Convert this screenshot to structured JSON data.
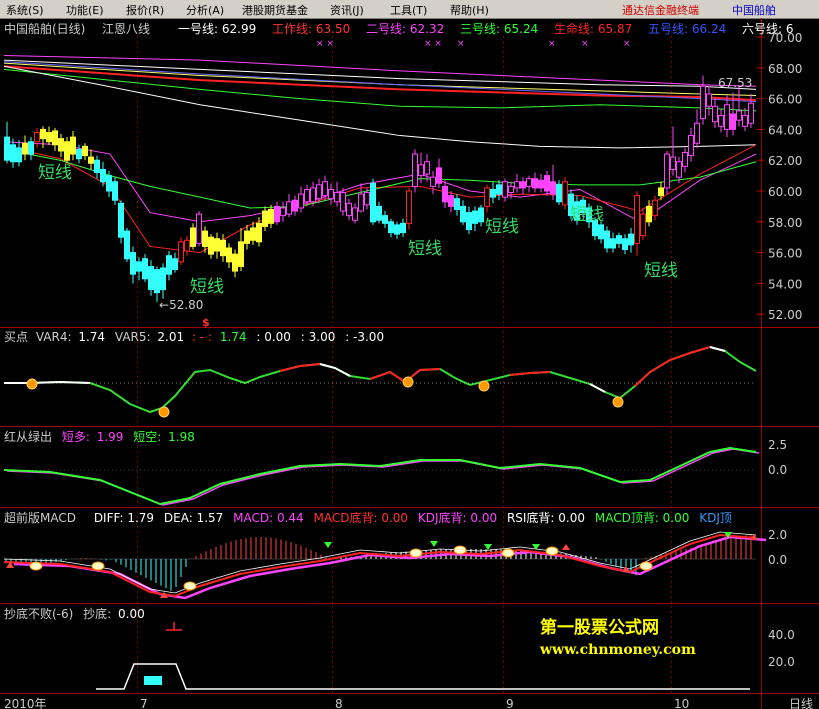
{
  "menu": {
    "items": [
      {
        "label": "系统(S)"
      },
      {
        "label": "功能(E)"
      },
      {
        "label": "报价(R)"
      },
      {
        "label": "分析(A)"
      },
      {
        "label": "港股期货基金"
      },
      {
        "label": "资讯(J)"
      },
      {
        "label": "工具(T)"
      },
      {
        "label": "帮助(H)"
      }
    ],
    "right_title": "通达信金融终端",
    "right_stock": "中国船舶"
  },
  "main_panel": {
    "stock_title": "中国船舶(日线)",
    "indicator_name": "江恩八线",
    "lines": [
      {
        "label": "一号线:",
        "value": "62.99",
        "color": "#ffffff"
      },
      {
        "label": "工作线:",
        "value": "63.50",
        "color": "#ff3333"
      },
      {
        "label": "二号线:",
        "value": "62.32",
        "color": "#ff44ff"
      },
      {
        "label": "三号线:",
        "value": "65.24",
        "color": "#33ff33"
      },
      {
        "label": "生命线:",
        "value": "65.87",
        "color": "#ff2222"
      },
      {
        "label": "五号线:",
        "value": "66.24",
        "color": "#3355ff"
      },
      {
        "label": "六号线:",
        "value": "6",
        "color": "#ffffff"
      }
    ],
    "y_axis": [
      "70.00",
      "68.00",
      "66.00",
      "64.00",
      "62.00",
      "60.00",
      "58.00",
      "56.00",
      "54.00",
      "52.00"
    ],
    "annotations": {
      "high": "67.53",
      "low": "52.80",
      "short_line": "短线",
      "dollar": "$"
    }
  },
  "panel2": {
    "label_name": "买点",
    "var4_label": "VAR4:",
    "var4": "1.74",
    "var5_label": "VAR5:",
    "var5": "2.01",
    "dash_sep": ": - :",
    "v3": "1.74",
    "v4": ": 0.00",
    "v5": ": 3.00",
    "v6": ": -3.00"
  },
  "panel3": {
    "name": "红从绿出",
    "a_label": "短多:",
    "a_value": "1.99",
    "b_label": "短空:",
    "b_value": "1.98",
    "y_axis": [
      "2.5",
      "0.0"
    ]
  },
  "panel4": {
    "name": "超前版MACD",
    "diff": "DIFF: 1.79",
    "dea": "DEA: 1.57",
    "macd": "MACD: 0.44",
    "macd_bottom": "MACD底背: 0.00",
    "kdj_bottom": "KDJ底背: 0.00",
    "rsi_bottom": "RSI底背: 0.00",
    "macd_top": "MACD顶背: 0.00",
    "kdj_top": "KDJ顶",
    "y_axis": [
      "2.0",
      "0.0"
    ]
  },
  "panel5": {
    "name": "抄底不败(-6)",
    "sub_label": "抄底:",
    "sub_value": "0.00",
    "y_axis": [
      "40.0",
      "20.0"
    ]
  },
  "watermark": {
    "title": "第一股票公式网",
    "url": "www.chnmoney.com"
  },
  "x_axis": {
    "year": "2010年",
    "months": [
      "7",
      "8",
      "9",
      "10"
    ],
    "period": "日线"
  }
}
